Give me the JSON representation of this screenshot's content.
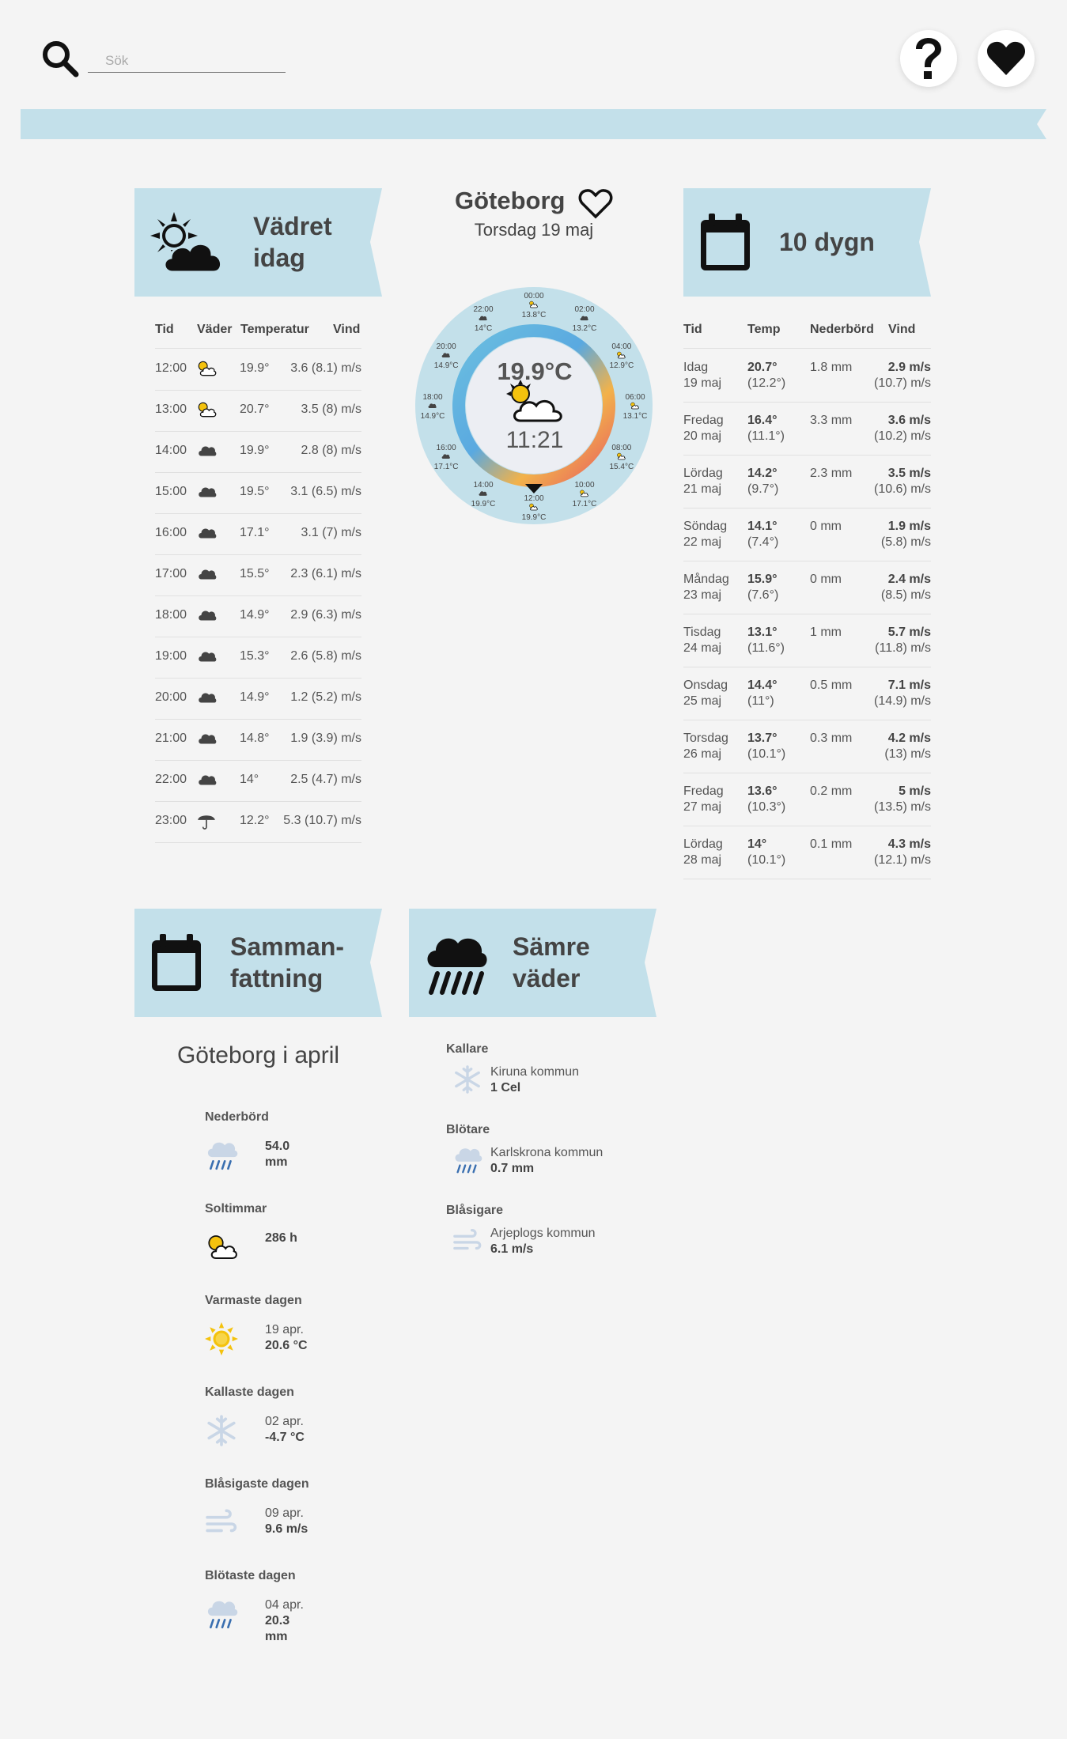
{
  "header": {
    "search_placeholder": "Sök",
    "help_icon": "question-icon",
    "favorites_icon": "heart-icon"
  },
  "today": {
    "title": "Vädret\nidag",
    "columns": [
      "Tid",
      "Väder",
      "Temperatur",
      "Vind"
    ],
    "rows": [
      {
        "time": "12:00",
        "icon": "sun-cloud-icon",
        "temp": "19.9°",
        "wind": "3.6 (8.1) m/s"
      },
      {
        "time": "13:00",
        "icon": "sun-cloud-icon",
        "temp": "20.7°",
        "wind": "3.5 (8) m/s"
      },
      {
        "time": "14:00",
        "icon": "cloud-icon",
        "temp": "19.9°",
        "wind": "2.8 (8) m/s"
      },
      {
        "time": "15:00",
        "icon": "cloud-icon",
        "temp": "19.5°",
        "wind": "3.1 (6.5) m/s"
      },
      {
        "time": "16:00",
        "icon": "cloud-icon",
        "temp": "17.1°",
        "wind": "3.1 (7) m/s"
      },
      {
        "time": "17:00",
        "icon": "cloud-icon",
        "temp": "15.5°",
        "wind": "2.3 (6.1) m/s"
      },
      {
        "time": "18:00",
        "icon": "cloud-icon",
        "temp": "14.9°",
        "wind": "2.9 (6.3) m/s"
      },
      {
        "time": "19:00",
        "icon": "cloud-icon",
        "temp": "15.3°",
        "wind": "2.6 (5.8) m/s"
      },
      {
        "time": "20:00",
        "icon": "cloud-icon",
        "temp": "14.9°",
        "wind": "1.2 (5.2) m/s"
      },
      {
        "time": "21:00",
        "icon": "cloud-icon",
        "temp": "14.8°",
        "wind": "1.9 (3.9) m/s"
      },
      {
        "time": "22:00",
        "icon": "cloud-icon",
        "temp": "14°",
        "wind": "2.5 (4.7) m/s"
      },
      {
        "time": "23:00",
        "icon": "umbrella-icon",
        "temp": "12.2°",
        "wind": "5.3 (10.7) m/s"
      }
    ]
  },
  "city": {
    "name": "Göteborg",
    "date": "Torsdag 19 maj",
    "current_temp": "19.9°C",
    "current_time": "11:21",
    "clock_labels": [
      {
        "time": "00:00",
        "temp": "13.8°C",
        "icon": "sun-cloud-icon"
      },
      {
        "time": "02:00",
        "temp": "13.2°C",
        "icon": "cloud-icon"
      },
      {
        "time": "04:00",
        "temp": "12.9°C",
        "icon": "sun-cloud-icon"
      },
      {
        "time": "06:00",
        "temp": "13.1°C",
        "icon": "sun-cloud-icon"
      },
      {
        "time": "08:00",
        "temp": "15.4°C",
        "icon": "sun-cloud-icon"
      },
      {
        "time": "10:00",
        "temp": "17.1°C",
        "icon": "sun-cloud-icon"
      },
      {
        "time": "12:00",
        "temp": "19.9°C",
        "icon": "sun-cloud-icon"
      },
      {
        "time": "14:00",
        "temp": "19.9°C",
        "icon": "cloud-icon"
      },
      {
        "time": "16:00",
        "temp": "17.1°C",
        "icon": "cloud-icon"
      },
      {
        "time": "18:00",
        "temp": "14.9°C",
        "icon": "cloud-icon"
      },
      {
        "time": "20:00",
        "temp": "14.9°C",
        "icon": "cloud-icon"
      },
      {
        "time": "22:00",
        "temp": "14°C",
        "icon": "cloud-icon"
      }
    ]
  },
  "ten_day": {
    "title": "10 dygn",
    "columns": [
      "Tid",
      "Temp",
      "Nederbörd",
      "Vind"
    ],
    "rows": [
      {
        "day": "Idag",
        "date": "19 maj",
        "temp": "20.7°",
        "low": "(12.2°)",
        "rain": "1.8 mm",
        "wind": "2.9 m/s",
        "gust": "(10.7) m/s"
      },
      {
        "day": "Fredag",
        "date": "20 maj",
        "temp": "16.4°",
        "low": "(11.1°)",
        "rain": "3.3 mm",
        "wind": "3.6 m/s",
        "gust": "(10.2) m/s"
      },
      {
        "day": "Lördag",
        "date": "21 maj",
        "temp": "14.2°",
        "low": "(9.7°)",
        "rain": "2.3 mm",
        "wind": "3.5 m/s",
        "gust": "(10.6) m/s"
      },
      {
        "day": "Söndag",
        "date": "22 maj",
        "temp": "14.1°",
        "low": "(7.4°)",
        "rain": "0 mm",
        "wind": "1.9 m/s",
        "gust": "(5.8) m/s"
      },
      {
        "day": "Måndag",
        "date": "23 maj",
        "temp": "15.9°",
        "low": "(7.6°)",
        "rain": "0 mm",
        "wind": "2.4 m/s",
        "gust": "(8.5) m/s"
      },
      {
        "day": "Tisdag",
        "date": "24 maj",
        "temp": "13.1°",
        "low": "(11.6°)",
        "rain": "1 mm",
        "wind": "5.7 m/s",
        "gust": "(11.8) m/s"
      },
      {
        "day": "Onsdag",
        "date": "25 maj",
        "temp": "14.4°",
        "low": "(11°)",
        "rain": "0.5 mm",
        "wind": "7.1 m/s",
        "gust": "(14.9) m/s"
      },
      {
        "day": "Torsdag",
        "date": "26 maj",
        "temp": "13.7°",
        "low": "(10.1°)",
        "rain": "0.3 mm",
        "wind": "4.2 m/s",
        "gust": "(13) m/s"
      },
      {
        "day": "Fredag",
        "date": "27 maj",
        "temp": "13.6°",
        "low": "(10.3°)",
        "rain": "0.2 mm",
        "wind": "5 m/s",
        "gust": "(13.5) m/s"
      },
      {
        "day": "Lördag",
        "date": "28 maj",
        "temp": "14°",
        "low": "(10.1°)",
        "rain": "0.1 mm",
        "wind": "4.3 m/s",
        "gust": "(12.1) m/s"
      }
    ]
  },
  "summary": {
    "title": "Samman-\nfattning",
    "heading": "Göteborg i april",
    "items": [
      {
        "label": "Nederbörd",
        "icon": "rain-cloud-icon",
        "line1": "54.0",
        "line2": "mm"
      },
      {
        "label": "Soltimmar",
        "icon": "sun-cloud-icon",
        "line1": "286 h",
        "line2": ""
      },
      {
        "label": "Varmaste dagen",
        "icon": "sun-icon",
        "line1": "19 apr.",
        "line2": "20.6 °C"
      },
      {
        "label": "Kallaste dagen",
        "icon": "snowflake-icon",
        "line1": "02 apr.",
        "line2": "-4.7 °C"
      },
      {
        "label": "Blåsigaste dagen",
        "icon": "wind-icon",
        "line1": "09 apr.",
        "line2": "9.6 m/s"
      },
      {
        "label": "Blötaste dagen",
        "icon": "rain-cloud-icon",
        "line1": "04 apr.",
        "line2": "20.3",
        "line3": "mm"
      }
    ]
  },
  "worse": {
    "title": "Sämre\nväder",
    "items": [
      {
        "label": "Kallare",
        "icon": "snowflake-icon",
        "place": "Kiruna kommun",
        "value": "1 Cel"
      },
      {
        "label": "Blötare",
        "icon": "rain-cloud-icon",
        "place": "Karlskrona kommun",
        "value": "0.7 mm"
      },
      {
        "label": "Blåsigare",
        "icon": "wind-icon",
        "place": "Arjeplogs kommun",
        "value": "6.1 m/s"
      }
    ]
  },
  "colors": {
    "ribbon": "#c3e0ea",
    "text": "#444444",
    "sun": "#f4c20d",
    "icon_pale": "#c9d6e6",
    "rain": "#3a6fb0"
  }
}
